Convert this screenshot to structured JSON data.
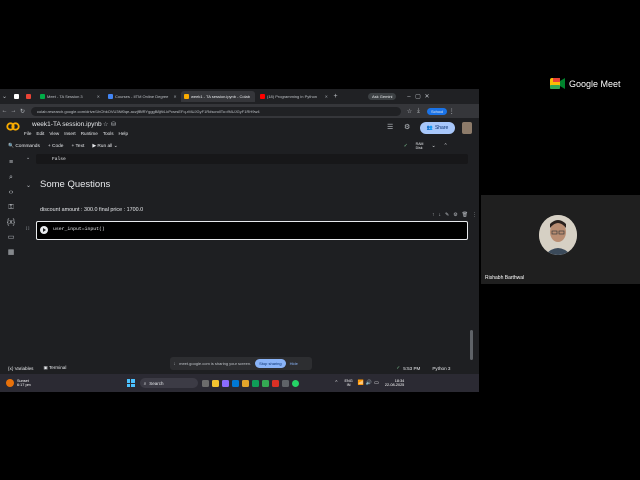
{
  "browser": {
    "tabs": [
      {
        "label": "",
        "color": "#ffffff"
      },
      {
        "label": "",
        "color": "#ea4335"
      },
      {
        "label": "Meet - TA Session 3",
        "color": "#00ac47"
      },
      {
        "label": "Courses - IITM Online Degree",
        "color": "#4285f4"
      },
      {
        "label": "week1 - TA session.ipynb - Colab",
        "color": "#f9ab00",
        "active": true
      },
      {
        "label": "(18) Programming in Python",
        "color": "#ff0000"
      }
    ],
    "new_tab": "+",
    "ask_gemini": "Ask Gemini",
    "url": "colab.research.google.com/drive/1hOhkOVU3Nf0qe-aczjfBfRYgggB8jft4-kPcsrsEFq-rMUJGyF1R#scrollTo=fMUJGyF1RH9w4",
    "profile_label": "School"
  },
  "colab": {
    "title": "week1-TA session.ipynb",
    "menu": [
      "File",
      "Edit",
      "View",
      "Insert",
      "Runtime",
      "Tools",
      "Help"
    ],
    "share_label": "Share",
    "toolbar": {
      "commands": "Commands",
      "code": "+ Code",
      "text": "+ Text",
      "run_all": "Run all",
      "ram": "RAM",
      "disk": "Disk"
    },
    "output_false": "False",
    "section_heading": "Some Questions",
    "printed_output": "discount amount : 300.0 final price : 1700.0",
    "code_line": "user_input=input()",
    "status": {
      "variables": "Variables",
      "terminal": "Terminal",
      "time": "5:53 PM",
      "runtime": "Python 3"
    }
  },
  "share_banner": {
    "message": "meet.google.com is sharing your screen.",
    "stop": "Stop sharing",
    "hide": "Hide"
  },
  "taskbar": {
    "weather_temp": "Sunset",
    "weather_time": "6:17 pm",
    "search": "Search",
    "lang_top": "ENG",
    "lang_bottom": "IN",
    "clock_time": "18:34",
    "clock_date": "22-08-2025"
  },
  "meet": {
    "brand": "Google Meet",
    "participant_name": "Rishabh Barthwal"
  }
}
